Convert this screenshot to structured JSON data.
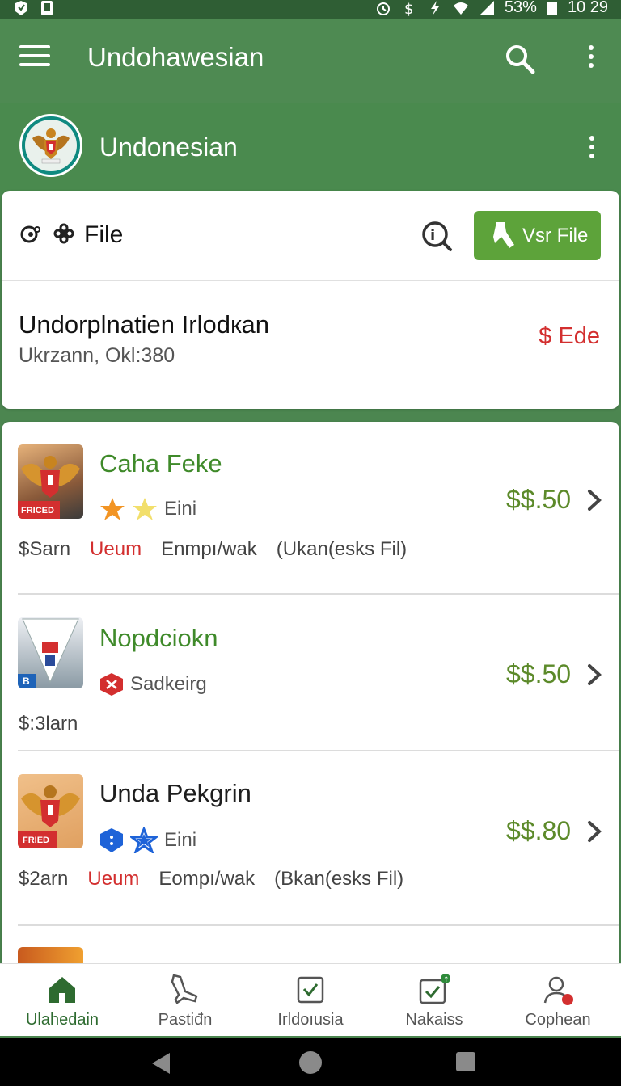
{
  "status_bar": {
    "battery": "53%",
    "time": "10 29",
    "icons": [
      "app-icon",
      "notification-icon",
      "alarm-icon",
      "dollar-icon",
      "flash-icon",
      "wifi-icon",
      "signal-icon",
      "battery-icon"
    ]
  },
  "app_bar": {
    "title": "Undohawesian",
    "icons": [
      "menu-icon",
      "search-icon",
      "more-vert-icon"
    ]
  },
  "header": {
    "name": "Undonesian",
    "avatar_icon": "garuda-emblem-icon"
  },
  "file_card": {
    "label": "File",
    "button_label": "Vsr File",
    "title": "Undorplnatien Irlodкan",
    "subtitle": "Ukrzann, Okl:380",
    "price": "$ Ede",
    "colors": {
      "button": "#5da33a",
      "price": "#d32f2f"
    }
  },
  "list": {
    "items": [
      {
        "title": "Caha Feke",
        "title_color": "#3f8a2a",
        "meta": "Eini",
        "badges": [
          "orange-star-icon",
          "yellow-star-icon"
        ],
        "detail_1": "$Sarn",
        "detail_2": "Ueum",
        "detail_3": "Enmpı/wak",
        "detail_4": "(Ukan(esks Fil)",
        "price": "$$.50",
        "thumb_caption": "FRICED"
      },
      {
        "title": "Nopdciokn",
        "title_color": "#3f8a2a",
        "meta": "Sadkeirg",
        "badges": [
          "red-emblem-icon"
        ],
        "detail_1": "$:3larn",
        "price": "$$.50",
        "thumb_caption": "B"
      },
      {
        "title": "Unda Pekgrin",
        "title_color": "#1e1e1e",
        "meta": "Eini",
        "badges": [
          "blue-shield-icon",
          "blue-star-icon"
        ],
        "detail_1": "$2arn",
        "detail_2": "Ueum",
        "detail_3": "Eompı/wak",
        "detail_4": "(Bkan(esks Fil)",
        "price": "$$.80",
        "thumb_caption": "FRIED"
      }
    ]
  },
  "bottom_nav": [
    {
      "label": "Ulahedain",
      "icon": "home-icon",
      "active": true
    },
    {
      "label": "Pastiđn",
      "icon": "plane-icon",
      "active": false
    },
    {
      "label": "Irldoıusia",
      "icon": "check-box-icon",
      "active": false
    },
    {
      "label": "Nakaiss",
      "icon": "task-icon",
      "active": false
    },
    {
      "label": "Cophean",
      "icon": "profile-icon",
      "active": false
    }
  ]
}
